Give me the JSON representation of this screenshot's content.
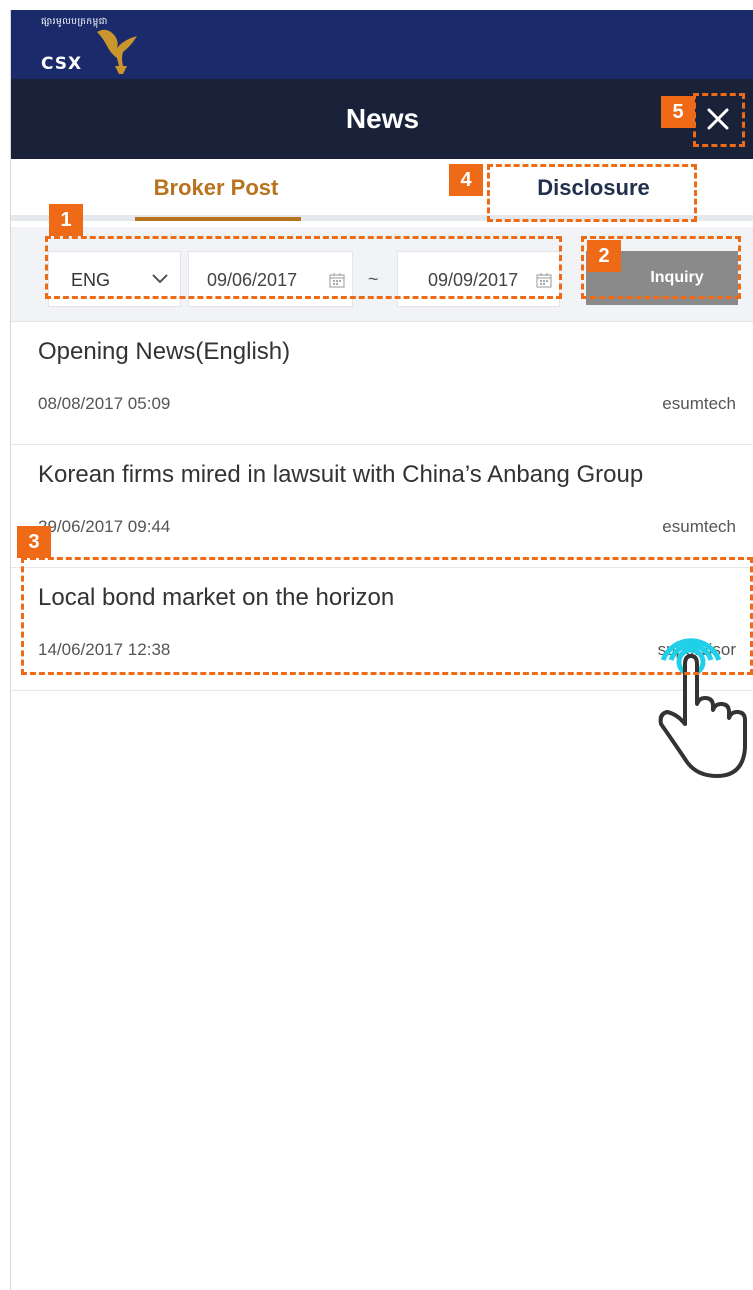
{
  "brand": {
    "khmer_text": "ផ្សារមូលបត្រកម្ពុជា",
    "abbr": "CSX",
    "header_color": "#1a2a6b"
  },
  "header": {
    "title": "News",
    "close_icon": "close-icon",
    "bg_color": "#1a223a"
  },
  "tabs": [
    {
      "label": "Broker Post",
      "active": true
    },
    {
      "label": "Disclosure",
      "active": false
    }
  ],
  "filter": {
    "language": "ENG",
    "date_from": "09/06/2017",
    "separator": "~",
    "date_to": "09/09/2017",
    "inquiry_label": "Inquiry"
  },
  "news": [
    {
      "title": "Opening News(English)",
      "date": "08/08/2017 05:09",
      "author": "esumtech"
    },
    {
      "title": "Korean firms mired in lawsuit with China’s Anbang Group",
      "date": "29/06/2017 09:44",
      "author": "esumtech"
    },
    {
      "title": "Local bond market on the horizon",
      "date": "14/06/2017 12:38",
      "author": "supervisor"
    }
  ],
  "callouts": {
    "c1": "1",
    "c2": "2",
    "c3": "3",
    "c4": "4",
    "c5": "5",
    "color": "#ef6a16"
  },
  "colors": {
    "accent": "#b8731f",
    "inquiry_bg": "#8a8a8a",
    "tap_indicator": "#1fd0e8"
  }
}
